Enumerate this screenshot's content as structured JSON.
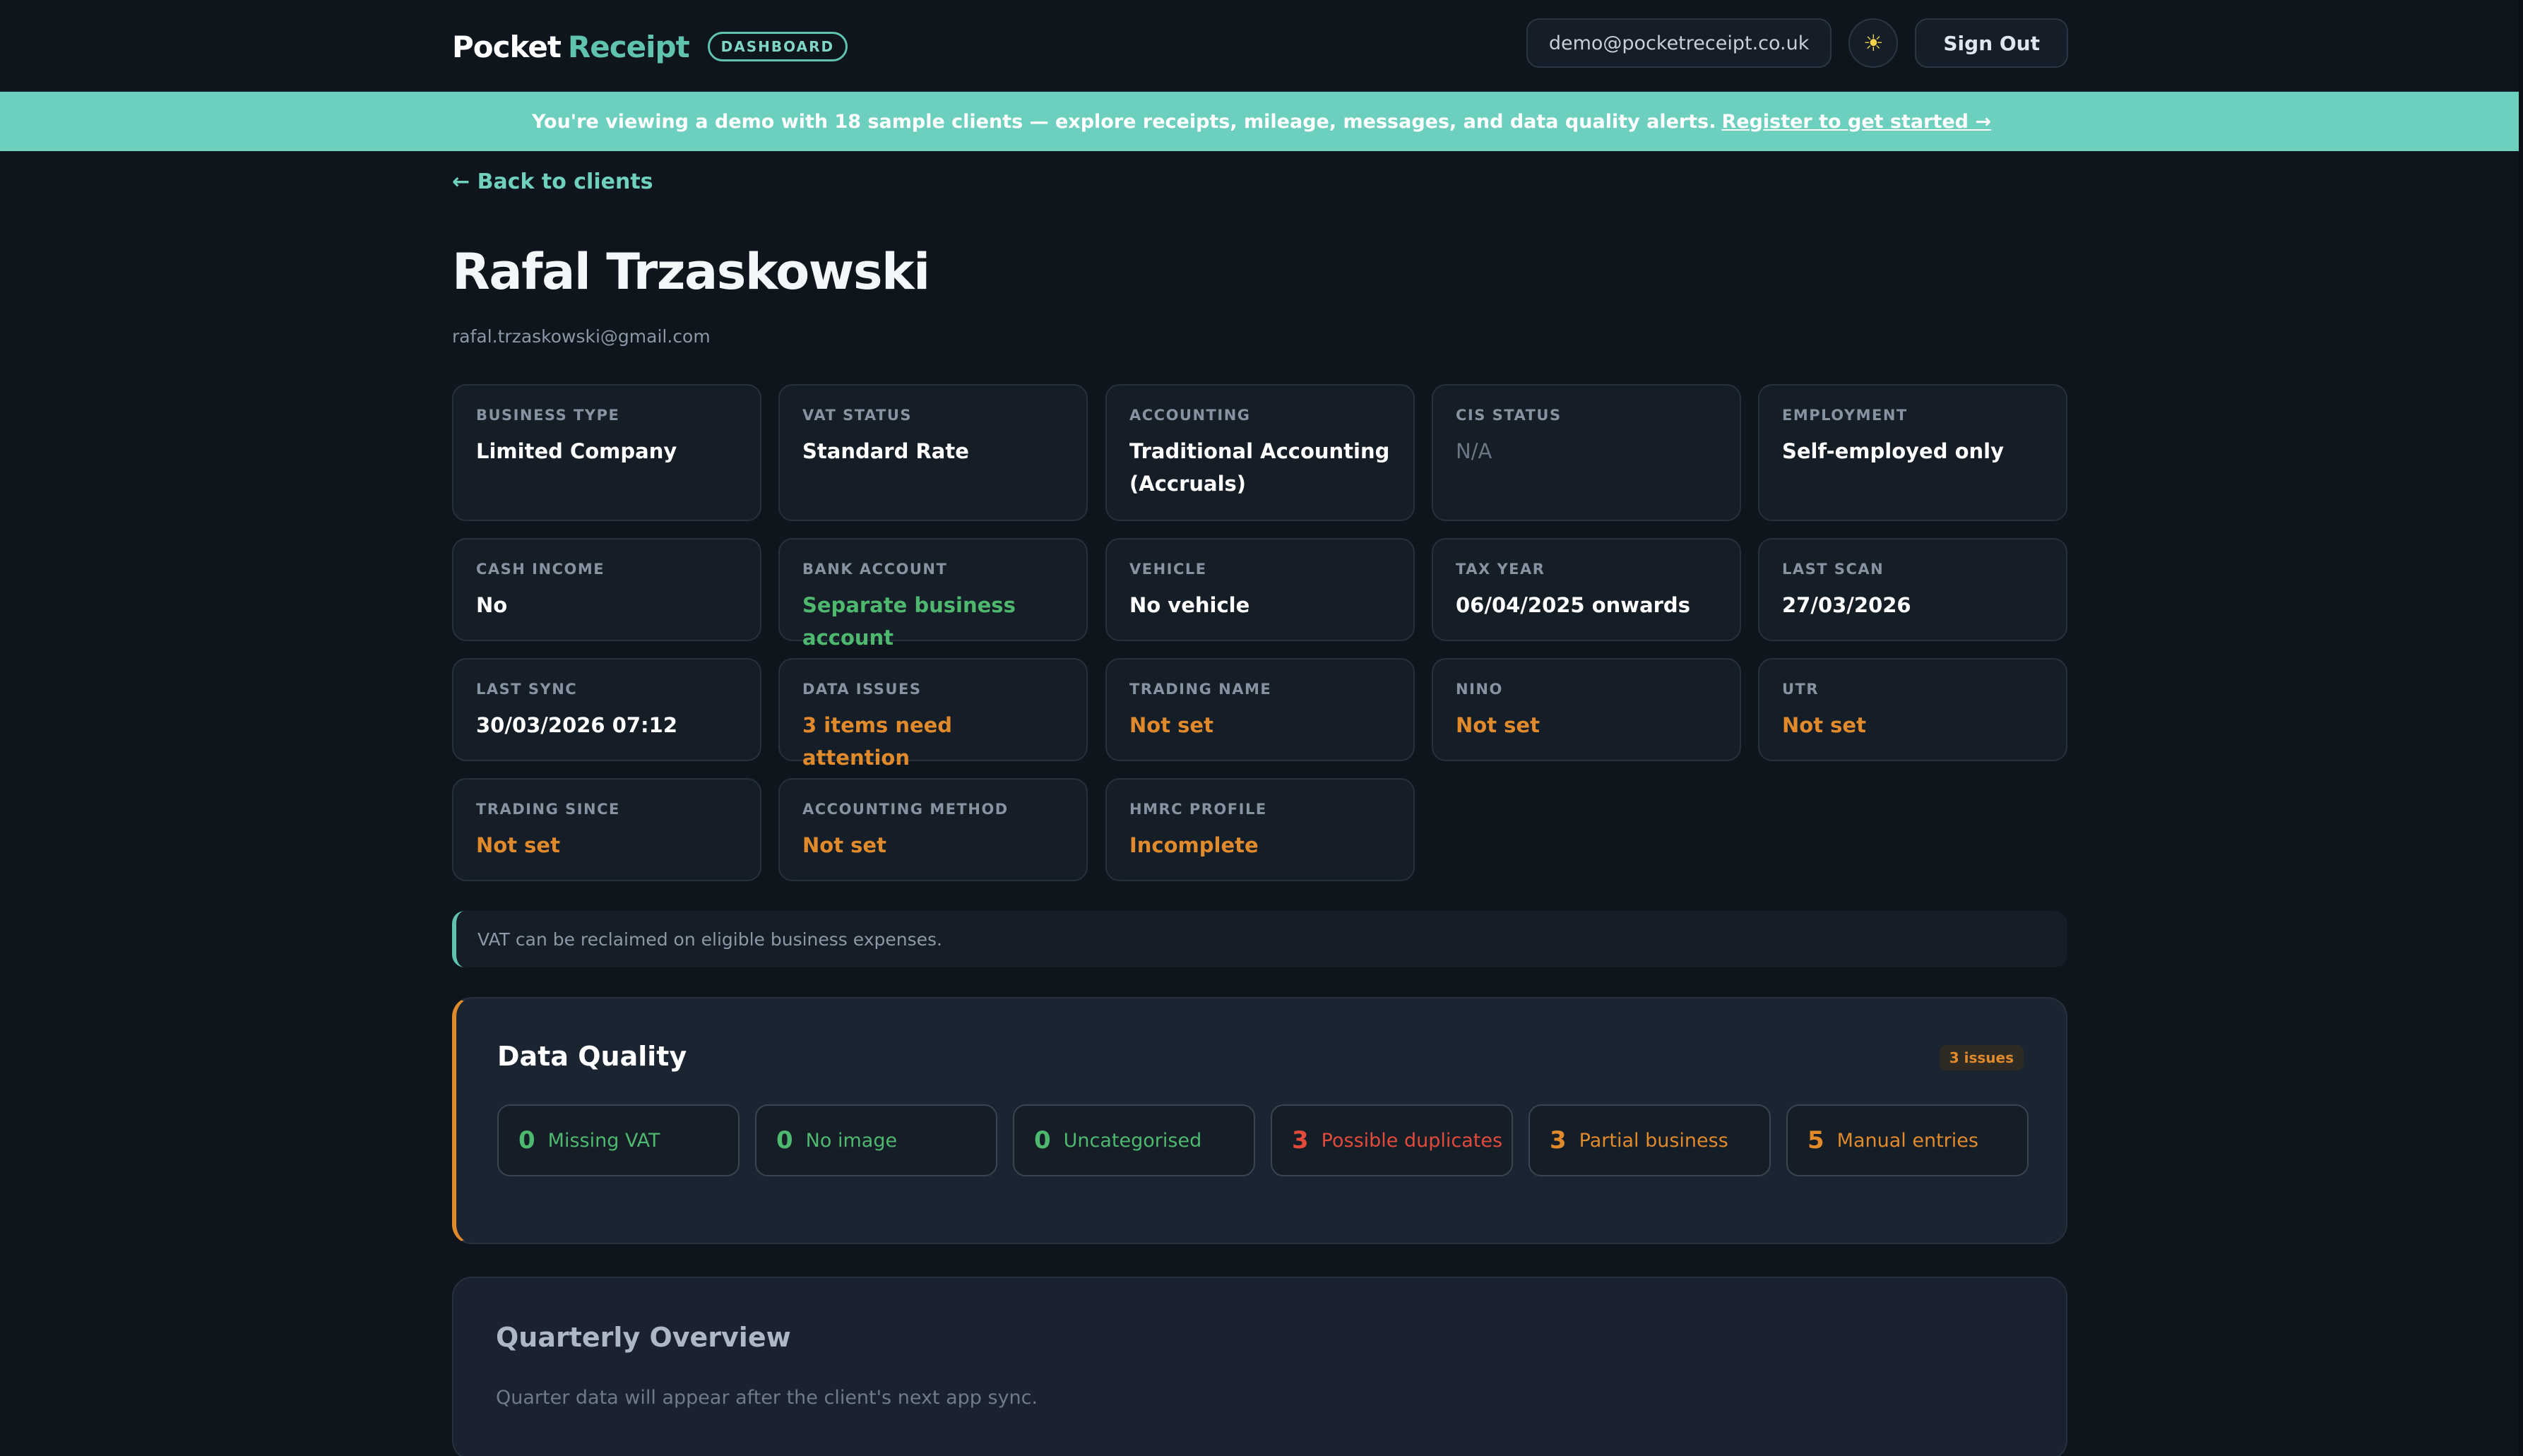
{
  "header": {
    "brand_primary": "Pocket",
    "brand_accent": "Receipt",
    "badge": "DASHBOARD",
    "user_email": "demo@pocketreceipt.co.uk",
    "theme_icon": "☀",
    "sign_out": "Sign Out"
  },
  "banner": {
    "text": "You're viewing a demo with 18 sample clients — explore receipts, mileage, messages, and data quality alerts.",
    "link": "Register to get started →"
  },
  "client": {
    "back_link": "← Back to clients",
    "name": "Rafal Trzaskowski",
    "email": "rafal.trzaskowski@gmail.com"
  },
  "cards": [
    {
      "label": "Business Type",
      "value": "Limited Company",
      "tone": "default"
    },
    {
      "label": "VAT Status",
      "value": "Standard Rate",
      "tone": "default"
    },
    {
      "label": "Accounting",
      "value": "Traditional Accounting (Accruals)",
      "tone": "default"
    },
    {
      "label": "CIS Status",
      "value": "N/A",
      "tone": "muted"
    },
    {
      "label": "Employment",
      "value": "Self-employed only",
      "tone": "default"
    },
    {
      "label": "Cash Income",
      "value": "No",
      "tone": "default"
    },
    {
      "label": "Bank Account",
      "value": "Separate business account",
      "tone": "green"
    },
    {
      "label": "Vehicle",
      "value": "No vehicle",
      "tone": "default"
    },
    {
      "label": "Tax Year",
      "value": "06/04/2025 onwards",
      "tone": "default"
    },
    {
      "label": "Last Scan",
      "value": "27/03/2026",
      "tone": "default"
    },
    {
      "label": "Last Sync",
      "value": "30/03/2026 07:12",
      "tone": "default"
    },
    {
      "label": "Data Issues",
      "value": "3 items need attention",
      "tone": "orange"
    },
    {
      "label": "Trading Name",
      "value": "Not set",
      "tone": "orange"
    },
    {
      "label": "NINO",
      "value": "Not set",
      "tone": "orange"
    },
    {
      "label": "UTR",
      "value": "Not set",
      "tone": "orange"
    },
    {
      "label": "Trading Since",
      "value": "Not set",
      "tone": "orange"
    },
    {
      "label": "Accounting Method",
      "value": "Not set",
      "tone": "orange"
    },
    {
      "label": "HMRC Profile",
      "value": "Incomplete",
      "tone": "orange"
    }
  ],
  "note": "VAT can be reclaimed on eligible business expenses.",
  "data_quality": {
    "title": "Data Quality",
    "badge": "3 issues",
    "items": [
      {
        "count": "0",
        "label": "Missing VAT",
        "tone": "green"
      },
      {
        "count": "0",
        "label": "No image",
        "tone": "green"
      },
      {
        "count": "0",
        "label": "Uncategorised",
        "tone": "green"
      },
      {
        "count": "3",
        "label": "Possible duplicates",
        "tone": "red"
      },
      {
        "count": "3",
        "label": "Partial business",
        "tone": "orange"
      },
      {
        "count": "5",
        "label": "Manual entries",
        "tone": "orange"
      }
    ]
  },
  "quarterly": {
    "title": "Quarterly Overview",
    "text": "Quarter data will appear after the client's next app sync."
  },
  "colors": {
    "accent": "#5fc3ae",
    "warning": "#e08a2c",
    "success": "#4fb86f",
    "danger": "#e24a3b",
    "background": "#0f151d"
  }
}
